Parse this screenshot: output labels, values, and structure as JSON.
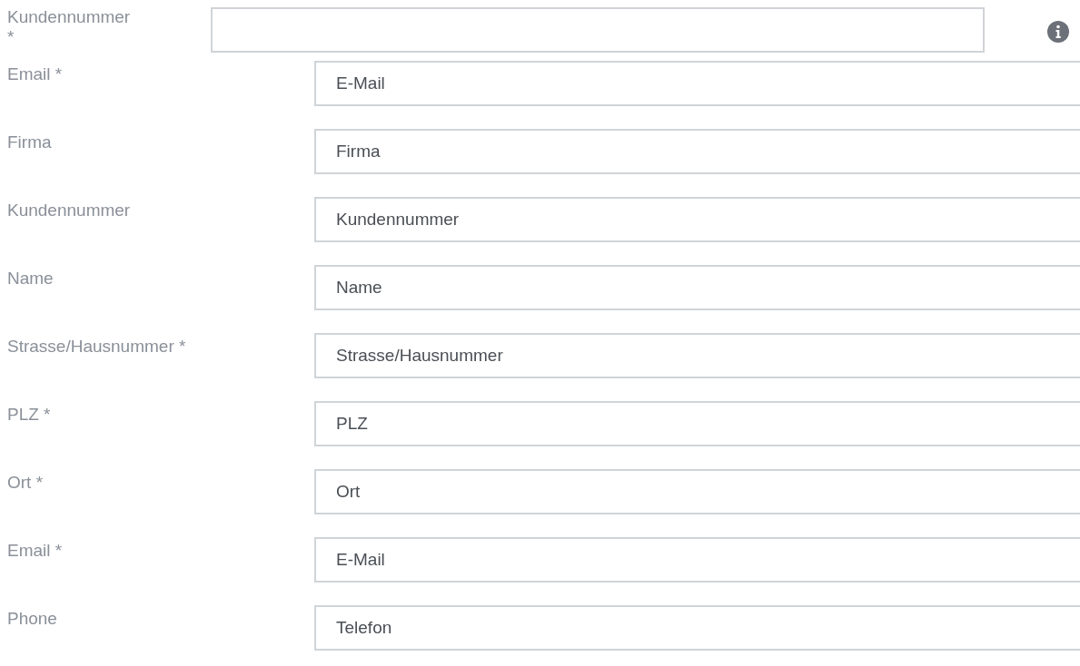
{
  "top_field": {
    "label": "Kundennummer *"
  },
  "fields": [
    {
      "label": "Email *",
      "placeholder": "E-Mail"
    },
    {
      "label": "Firma",
      "placeholder": "Firma"
    },
    {
      "label": "Kundennummer",
      "placeholder": "Kundennummer"
    },
    {
      "label": "Name",
      "placeholder": "Name"
    },
    {
      "label": "Strasse/Hausnummer *",
      "placeholder": "Strasse/Hausnummer"
    },
    {
      "label": "PLZ *",
      "placeholder": "PLZ"
    },
    {
      "label": "Ort *",
      "placeholder": "Ort"
    },
    {
      "label": "Email *",
      "placeholder": "E-Mail"
    },
    {
      "label": "Phone",
      "placeholder": "Telefon"
    }
  ]
}
